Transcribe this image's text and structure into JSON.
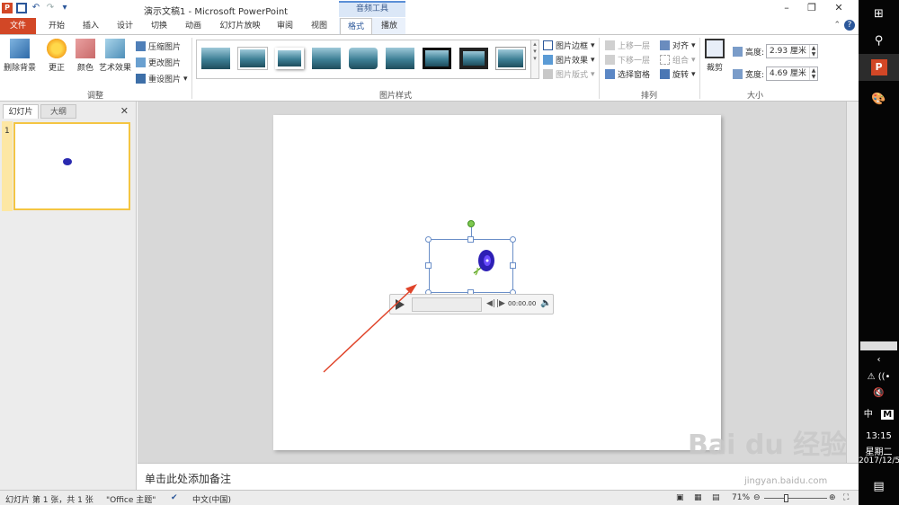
{
  "window": {
    "title": "演示文稿1 - Microsoft PowerPoint",
    "context_tools_label": "音频工具",
    "minimize": "–",
    "restore": "❐",
    "close": "✕"
  },
  "qat": {
    "ppt_logo": "P"
  },
  "tabs": [
    "文件",
    "开始",
    "插入",
    "设计",
    "切换",
    "动画",
    "幻灯片放映",
    "审阅",
    "视图",
    "格式",
    "播放"
  ],
  "active_tab": "格式",
  "ribbon": {
    "adjust": {
      "remove_bg": "删除背景",
      "corrections": "更正",
      "color": "颜色",
      "artistic": "艺术效果",
      "compress": "压缩图片",
      "change": "更改图片",
      "reset": "重设图片",
      "group_label": "调整"
    },
    "styles": {
      "border": "图片边框",
      "effects": "图片效果",
      "layout": "图片版式",
      "group_label": "图片样式"
    },
    "arrange": {
      "bring_forward": "上移一层",
      "send_backward": "下移一层",
      "selection_pane": "选择窗格",
      "align": "对齐",
      "group": "组合",
      "rotate": "旋转",
      "group_label": "排列"
    },
    "size": {
      "crop": "裁剪",
      "height_label": "高度:",
      "height_value": "2.93 厘米",
      "width_label": "宽度:",
      "width_value": "4.69 厘米",
      "group_label": "大小"
    }
  },
  "left_panel": {
    "tab_slides": "幻灯片",
    "tab_outline": "大纲",
    "slide_number": "1"
  },
  "player": {
    "time": "00:00.00"
  },
  "notes": {
    "placeholder": "单击此处添加备注"
  },
  "status": {
    "slide_info": "幻灯片 第 1 张，共 1 张",
    "theme": "\"Office 主题\"",
    "language": "中文(中国)",
    "zoom": "71%"
  },
  "taskbar": {
    "ime_lang": "中",
    "ime_mode": "M",
    "time": "13:15",
    "weekday": "星期二",
    "date": "2017/12/5"
  },
  "watermark": {
    "text": "Bai du 经验",
    "url": "jingyan.baidu.com"
  },
  "colors": {
    "accent": "#2b579a",
    "file_tab": "#d24726",
    "arrow": "#e0442a"
  },
  "icons": {
    "close": "close-icon",
    "play": "play-icon",
    "volume": "volume-icon",
    "search": "search-icon",
    "help": "help-icon"
  }
}
